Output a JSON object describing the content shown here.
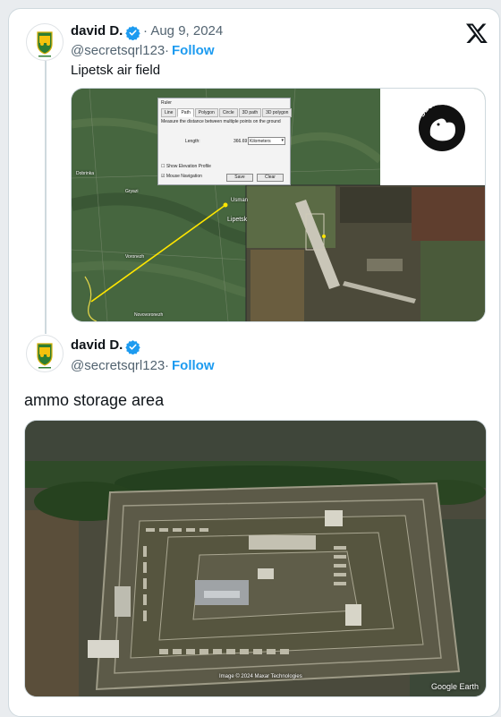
{
  "tweet1": {
    "author": "david D.",
    "date": "· Aug 9, 2024",
    "handle": "@secretsqrl123",
    "dot": "·",
    "follow": "Follow",
    "text": "Lipetsk air field"
  },
  "tweet2": {
    "author": "david D.",
    "handle": "@secretsqrl123",
    "dot": "·",
    "follow": "Follow",
    "text": "ammo storage area"
  },
  "ruler_dialog": {
    "title": "Ruler",
    "tabs": [
      "Line",
      "Path",
      "Polygon",
      "Circle",
      "3D path",
      "3D polygon"
    ],
    "active_tab": "Path",
    "instructions": "Measure the distance between multiple points on the ground",
    "length_label": "Length:",
    "length_value": "366.69",
    "unit": "Kilometers",
    "show_elevation": "Show Elevation Profile",
    "mouse_nav": "Mouse Navigation",
    "save": "Save",
    "clear": "Clear"
  },
  "map_labels": {
    "lipetsk": "Lipetsk",
    "city2": "Usman",
    "city3": "Gryazi",
    "city4": "Dobrinka",
    "city5": "Voronezh",
    "city6": "Novovoronezh"
  },
  "footer": {
    "imagery_credit": "Image © 2024 Maxar Technologies",
    "brand": "Google Earth"
  },
  "colors": {
    "brand_blue": "#1d9bf0",
    "avatar_green": "#2e7d32",
    "avatar_yellow": "#f4c20d"
  }
}
